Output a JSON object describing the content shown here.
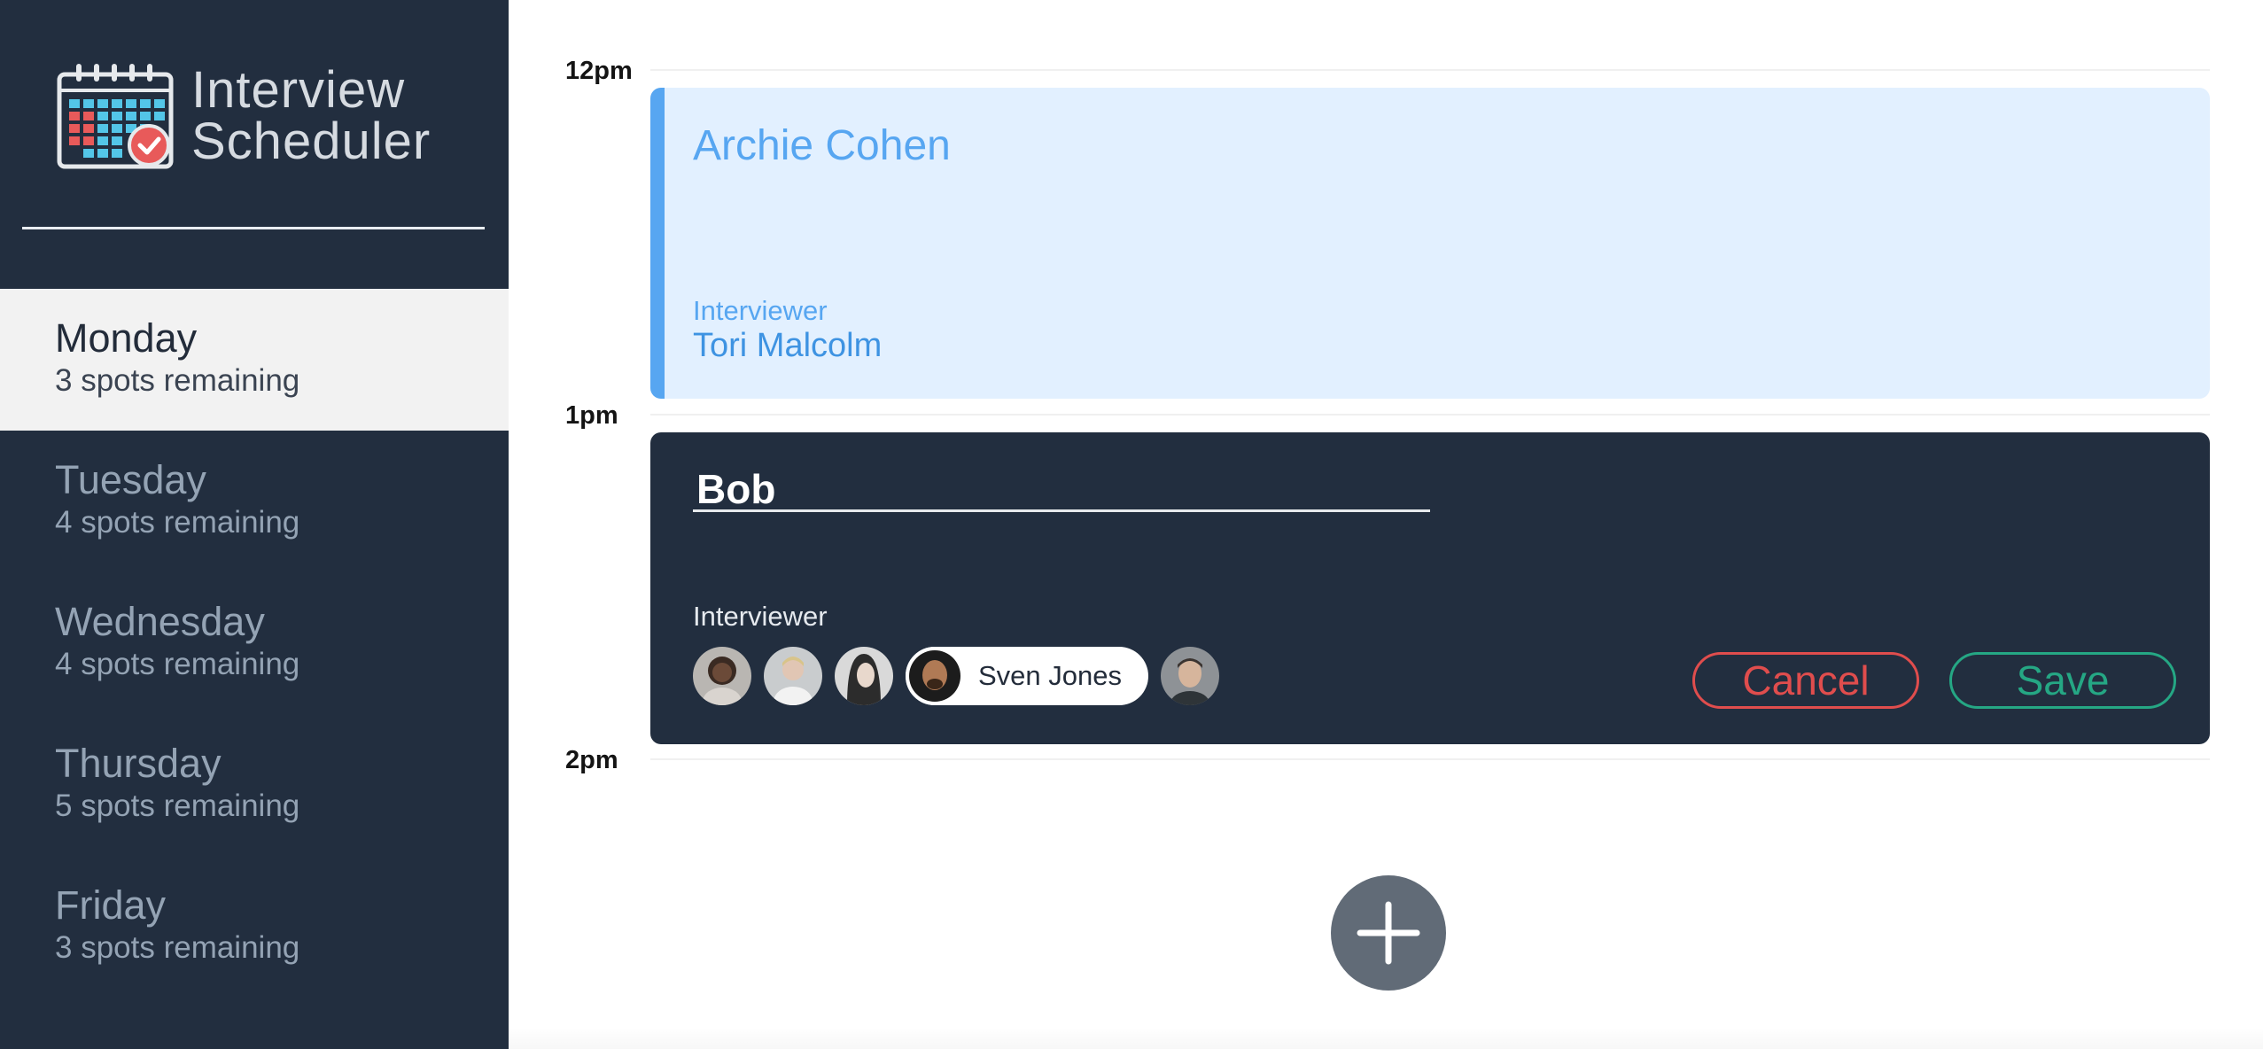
{
  "app": {
    "title_line1": "Interview",
    "title_line2": "Scheduler"
  },
  "days": [
    {
      "name": "Monday",
      "spots": "3 spots remaining",
      "selected": true
    },
    {
      "name": "Tuesday",
      "spots": "4 spots remaining",
      "selected": false
    },
    {
      "name": "Wednesday",
      "spots": "4 spots remaining",
      "selected": false
    },
    {
      "name": "Thursday",
      "spots": "5 spots remaining",
      "selected": false
    },
    {
      "name": "Friday",
      "spots": "3 spots remaining",
      "selected": false
    }
  ],
  "times": [
    "12pm",
    "1pm",
    "2pm"
  ],
  "booked": {
    "student": "Archie Cohen",
    "interviewer_label": "Interviewer",
    "interviewer_name": "Tori Malcolm"
  },
  "form": {
    "student_value": "Bob",
    "interviewer_label": "Interviewer",
    "selected_interviewer": "Sven Jones",
    "cancel_label": "Cancel",
    "save_label": "Save"
  },
  "colors": {
    "sidebar_bg": "#222e3f",
    "booked_accent": "#57a6f1",
    "cancel": "#e04d4d",
    "save": "#25a784"
  }
}
